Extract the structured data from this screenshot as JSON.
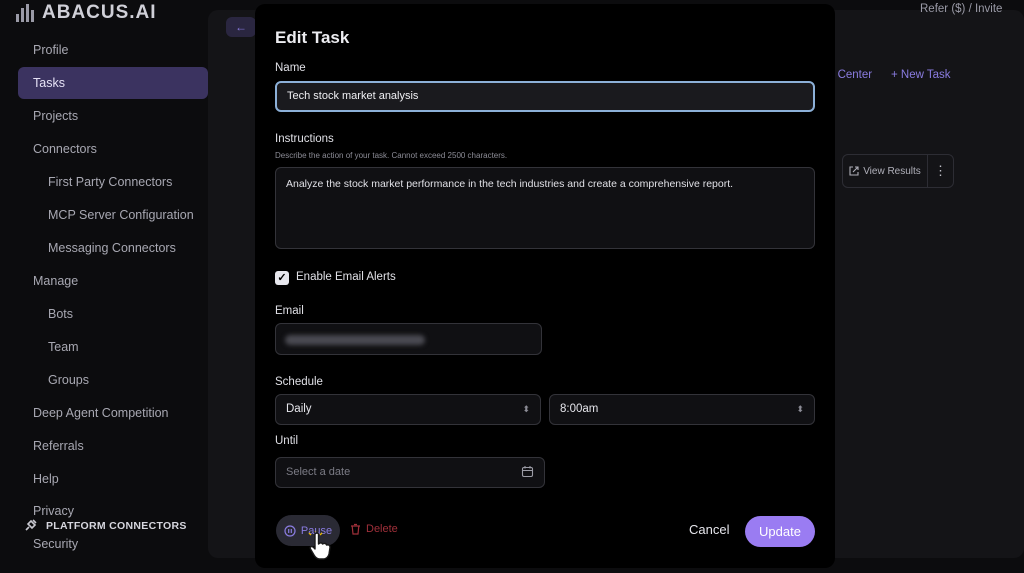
{
  "app": {
    "logo_text": "ABACUS.AI"
  },
  "top_bar": {
    "refer_text": "Refer ($) / Invite"
  },
  "sidebar": {
    "items": [
      {
        "label": "Profile"
      },
      {
        "label": "Tasks",
        "active": true
      },
      {
        "label": "Projects"
      },
      {
        "label": "Connectors"
      },
      {
        "label": "First Party Connectors",
        "sub": true
      },
      {
        "label": "MCP Server Configuration",
        "sub": true
      },
      {
        "label": "Messaging Connectors",
        "sub": true
      },
      {
        "label": "Manage"
      },
      {
        "label": "Bots",
        "sub": true
      },
      {
        "label": "Team",
        "sub": true
      },
      {
        "label": "Groups",
        "sub": true
      },
      {
        "label": "Deep Agent Competition"
      },
      {
        "label": "Referrals"
      },
      {
        "label": "Help"
      },
      {
        "label": "Privacy"
      },
      {
        "label": "Security"
      }
    ],
    "platform_connectors": "PLATFORM CONNECTORS"
  },
  "main": {
    "help_center": "a Center",
    "new_task": "+ New Task",
    "view_results": "View Results"
  },
  "modal": {
    "title": "Edit Task",
    "name_label": "Name",
    "name_value": "Tech stock market analysis",
    "instructions_label": "Instructions",
    "instructions_hint": "Describe the action of your task. Cannot exceed 2500 characters.",
    "instructions_value": "Analyze the stock market performance in the tech industries and create a comprehensive report.",
    "email_alerts_label": "Enable Email Alerts",
    "email_alerts_checked": true,
    "email_label": "Email",
    "schedule_label": "Schedule",
    "schedule_frequency": "Daily",
    "schedule_time": "8:00am",
    "until_label": "Until",
    "until_placeholder": "Select a date",
    "pause_label": "Pause",
    "delete_label": "Delete",
    "cancel_label": "Cancel",
    "update_label": "Update"
  },
  "colors": {
    "accent": "#9a7cf2",
    "active_nav": "#3b3360",
    "danger": "#a0303a",
    "focus_border": "#8cb0d8"
  }
}
